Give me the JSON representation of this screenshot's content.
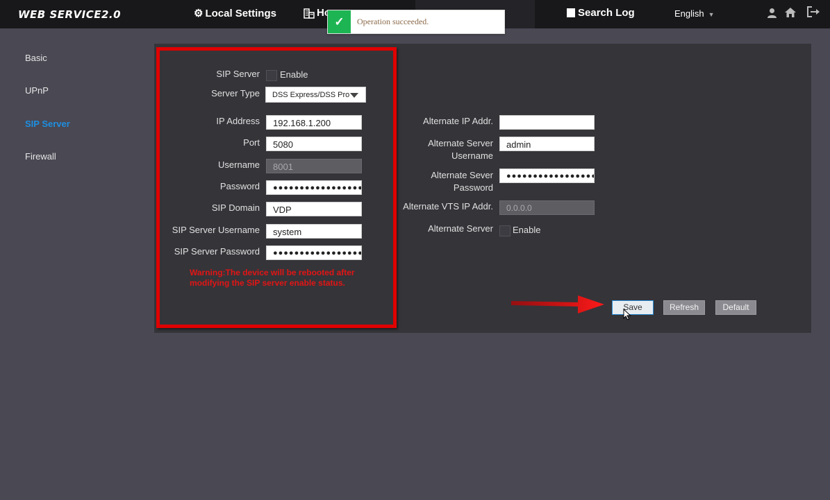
{
  "app": {
    "brand": "WEB SERVICE2.0"
  },
  "nav": {
    "local_settings": "Local Settings",
    "household_settings_partial": "Ho",
    "search_log": "Search Log",
    "language": "English"
  },
  "toast": {
    "message": "Operation succeeded."
  },
  "sidebar": {
    "items": [
      {
        "label": "Basic"
      },
      {
        "label": "UPnP"
      },
      {
        "label": "SIP Server"
      },
      {
        "label": "Firewall"
      }
    ]
  },
  "form_left": {
    "sip_server_label": "SIP Server",
    "sip_server_enable_label": "Enable",
    "server_type_label": "Server Type",
    "server_type_value": "DSS Express/DSS Pro",
    "ip_address_label": "IP Address",
    "ip_address_value": "192.168.1.200",
    "port_label": "Port",
    "port_value": "5080",
    "username_label": "Username",
    "username_value": "8001",
    "password_label": "Password",
    "password_value": "●●●●●●●●●●●●●●●●●●",
    "sip_domain_label": "SIP Domain",
    "sip_domain_value": "VDP",
    "sip_server_username_label": "SIP Server Username",
    "sip_server_username_value": "system",
    "sip_server_password_label": "SIP Server Password",
    "sip_server_password_value": "●●●●●●●●●●●●●●●●●●",
    "warning": "Warning:The device will be rebooted after modifying the SIP server enable status."
  },
  "form_right": {
    "alt_ip_label": "Alternate IP Addr.",
    "alt_ip_value": "",
    "alt_server_username_label_1": "Alternate Server",
    "alt_server_username_label_2": "Username",
    "alt_server_username_value": "admin",
    "alt_server_password_label_1": "Alternate Sever",
    "alt_server_password_label_2": "Password",
    "alt_server_password_value": "●●●●●●●●●●●●●●●●●●",
    "alt_vts_ip_label": "Alternate VTS IP Addr.",
    "alt_vts_ip_value": "0.0.0.0",
    "alt_server_label": "Alternate Server",
    "alt_server_enable_label": "Enable"
  },
  "actions": {
    "save": "Save",
    "refresh": "Refresh",
    "default": "Default"
  },
  "colors": {
    "active_sidebar": "#1e8fe0",
    "highlight": "#e00000",
    "toast_success": "#1db554"
  }
}
